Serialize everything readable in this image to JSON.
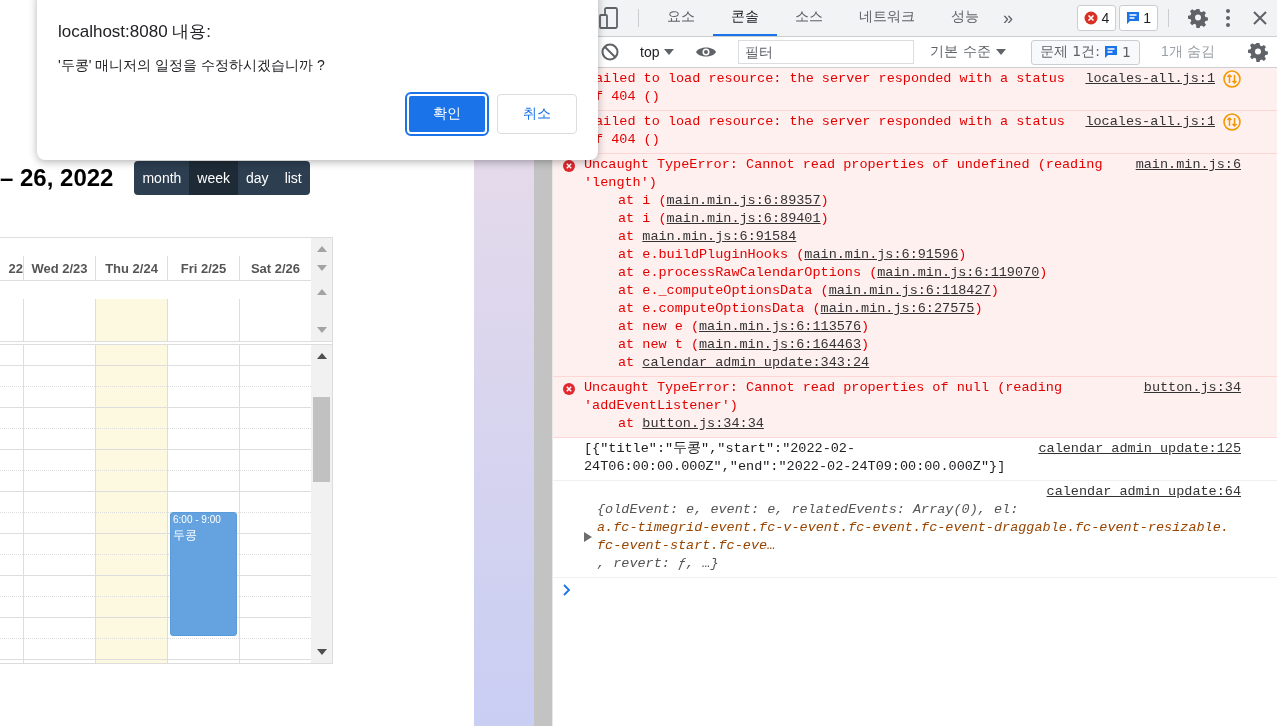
{
  "dialog": {
    "origin": "localhost:8080 내용:",
    "message": "'두콩' 매니저의 일정을 수정하시겠습니까 ?",
    "buttons": [
      {
        "label": "확인",
        "kind": "primary"
      },
      {
        "label": "취소",
        "kind": "secondary"
      }
    ]
  },
  "calendar": {
    "title": "– 26, 2022",
    "views": [
      {
        "label": "month",
        "selected": false
      },
      {
        "label": "week",
        "selected": true
      },
      {
        "label": "day",
        "selected": false
      },
      {
        "label": "list",
        "selected": false
      }
    ],
    "days": [
      {
        "label": "22",
        "today": false
      },
      {
        "label": "Wed 2/23",
        "today": false
      },
      {
        "label": "Thu 2/24",
        "today": true
      },
      {
        "label": "Fri 2/25",
        "today": false,
        "event": {
          "time": "6:00 - 9:00",
          "title": "두콩"
        }
      },
      {
        "label": "Sat 2/26",
        "today": false
      }
    ]
  },
  "devtools": {
    "tabs": [
      {
        "label": "요소",
        "selected": false
      },
      {
        "label": "콘솔",
        "selected": true
      },
      {
        "label": "소스",
        "selected": false
      },
      {
        "label": "네트워크",
        "selected": false
      },
      {
        "label": "성능",
        "selected": false
      }
    ],
    "more_tabs": "»",
    "error_count": "4",
    "message_count": "1",
    "toolbar": {
      "context": "top",
      "filter_placeholder": "필터",
      "levels": "기본 수준",
      "issues_label": "문제 1건:",
      "issues_count": "1",
      "hidden": "1개 숨김"
    },
    "messages": [
      {
        "kind": "error",
        "icon": false,
        "network": true,
        "lines": [
          "ailed to load resource: the server responded with a status",
          "f 404 ()"
        ],
        "source": "locales-all.js:1"
      },
      {
        "kind": "error",
        "icon": false,
        "network": true,
        "lines": [
          "ailed to load resource: the server responded with a status",
          "f 404 ()"
        ],
        "source": "locales-all.js:1"
      },
      {
        "kind": "error",
        "icon": true,
        "network": false,
        "lines": [
          "Uncaught TypeError: Cannot read properties of undefined (reading",
          "'length')"
        ],
        "source": "main.min.js:6",
        "stack": [
          {
            "prefix": "at i (",
            "link": "main.min.js:6:89357",
            "suffix": ")"
          },
          {
            "prefix": "at i (",
            "link": "main.min.js:6:89401",
            "suffix": ")"
          },
          {
            "prefix": "at ",
            "link": "main.min.js:6:91584"
          },
          {
            "prefix": "at e.buildPluginHooks (",
            "link": "main.min.js:6:91596",
            "suffix": ")"
          },
          {
            "prefix": "at e.processRawCalendarOptions (",
            "link": "main.min.js:6:119070",
            "suffix": ")"
          },
          {
            "prefix": "at e._computeOptionsData (",
            "link": "main.min.js:6:118427",
            "suffix": ")"
          },
          {
            "prefix": "at e.computeOptionsData (",
            "link": "main.min.js:6:27575",
            "suffix": ")"
          },
          {
            "prefix": "at new e (",
            "link": "main.min.js:6:113576",
            "suffix": ")"
          },
          {
            "prefix": "at new t (",
            "link": "main.min.js:6:164463",
            "suffix": ")"
          },
          {
            "prefix": "at ",
            "link": "calendar_admin_update:343:24"
          }
        ]
      },
      {
        "kind": "error",
        "icon": true,
        "network": false,
        "lines": [
          "Uncaught TypeError: Cannot read properties of null (reading",
          "'addEventListener')"
        ],
        "source": "button.js:34",
        "stack": [
          {
            "prefix": "at ",
            "link": "button.js:34:34"
          }
        ]
      },
      {
        "kind": "log",
        "lines": [
          "[{\"title\":\"두콩\",\"start\":\"2022-02-",
          "24T06:00:00.000Z\",\"end\":\"2022-02-24T09:00:00.000Z\"}]"
        ],
        "source": "calendar_admin_update:125"
      },
      {
        "kind": "object",
        "expanded": false,
        "source": "calendar_admin_update:64",
        "object_lines": [
          {
            "text": "{oldEvent: e, event: e, relatedEvents: Array(0), el:",
            "kind": "plain"
          },
          {
            "text": "a.fc-timegrid-event.fc-v-event.fc-event.fc-event-draggable.fc-event-resizable.",
            "kind": "element"
          },
          {
            "text": "fc-event-start.fc-eve…",
            "kind": "element"
          },
          {
            "text": ", revert: ƒ, …}",
            "kind": "plain"
          }
        ]
      }
    ]
  }
}
